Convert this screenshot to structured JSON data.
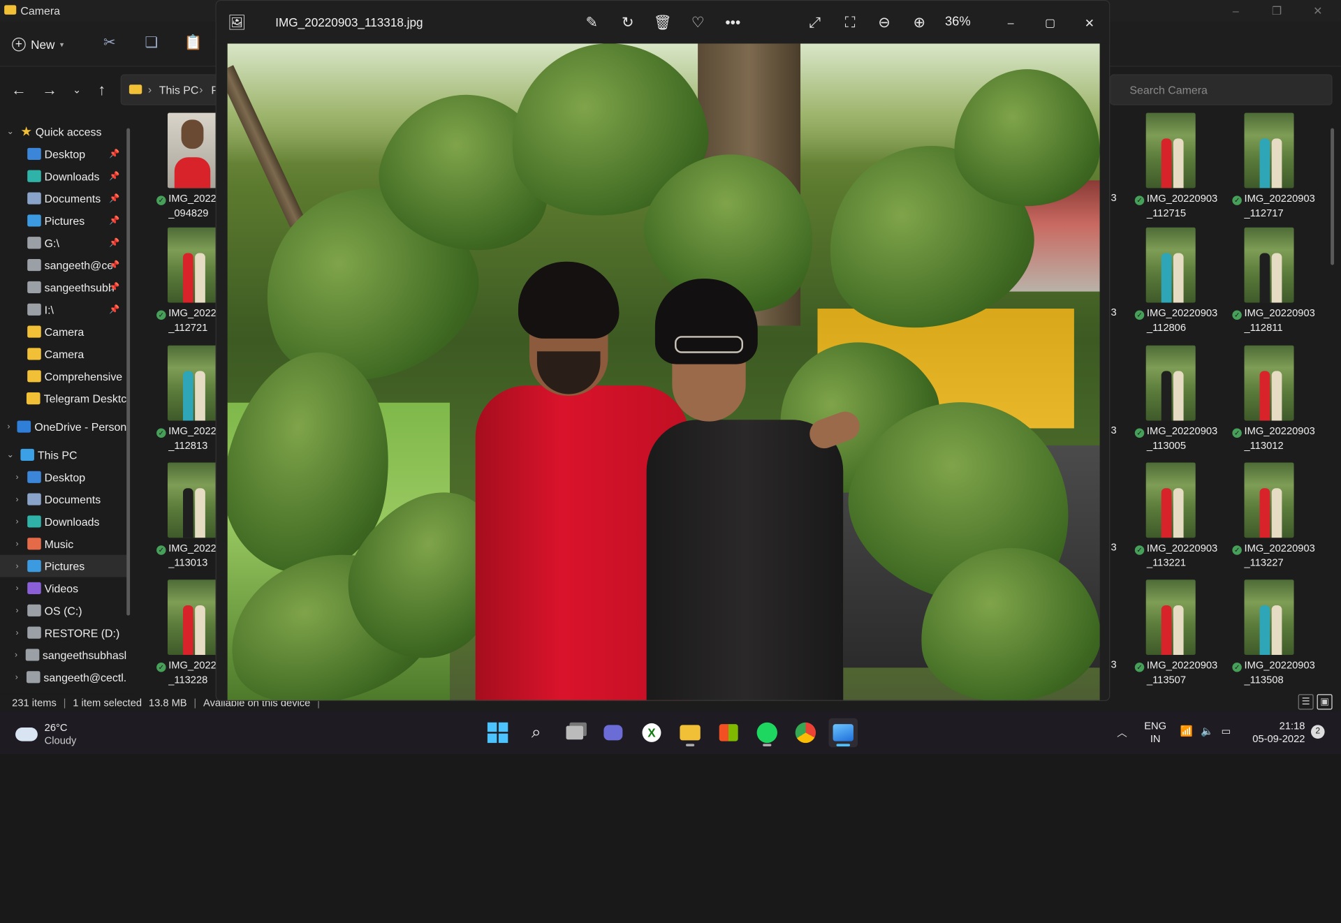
{
  "explorer": {
    "window_title": "Camera",
    "new_label": "New",
    "breadcrumb": [
      "This PC",
      "P"
    ],
    "search_placeholder": "Search Camera",
    "nav": {
      "quick_access": "Quick access",
      "items": [
        "Desktop",
        "Downloads",
        "Documents",
        "Pictures",
        "G:\\",
        "sangeeth@ce",
        "sangeethsubh",
        "I:\\",
        "Camera",
        "Camera",
        "Comprehensive",
        "Telegram Desktc",
        "OneDrive - Person",
        "This PC",
        "Desktop",
        "Documents",
        "Downloads",
        "Music",
        "Pictures",
        "Videos",
        "OS (C:)",
        "RESTORE (D:)",
        "sangeethsubhasl",
        "sangeeth@cectl."
      ]
    },
    "left_files": [
      {
        "line1": "IMG_2022",
        "line2": "_094829"
      },
      {
        "line1": "IMG_2022",
        "line2": "_112721"
      },
      {
        "line1": "IMG_2022",
        "line2": "_112813"
      },
      {
        "line1": "IMG_2022",
        "line2": "_113013"
      },
      {
        "line1": "IMG_2022",
        "line2": "_113228"
      }
    ],
    "right_files": [
      {
        "line1": "IMG_20220903",
        "line2": "_112715"
      },
      {
        "line1": "IMG_20220903",
        "line2": "_112717"
      },
      {
        "line1": "IMG_20220903",
        "line2": "_112806"
      },
      {
        "line1": "IMG_20220903",
        "line2": "_112811"
      },
      {
        "line1": "IMG_20220903",
        "line2": "_113005"
      },
      {
        "line1": "IMG_20220903",
        "line2": "_113012"
      },
      {
        "line1": "IMG_20220903",
        "line2": "_113221"
      },
      {
        "line1": "IMG_20220903",
        "line2": "_113227"
      },
      {
        "line1": "IMG_20220903",
        "line2": "_113507"
      },
      {
        "line1": "IMG_20220903",
        "line2": "_113508"
      }
    ],
    "partial_digit": "3",
    "status": {
      "items": "231 items",
      "selected": "1 item selected",
      "size": "13.8 MB",
      "availability": "Available on this device"
    }
  },
  "viewer": {
    "filename": "IMG_20220903_113318.jpg",
    "zoom": "36%"
  },
  "taskbar": {
    "temperature": "26°C",
    "condition": "Cloudy",
    "lang": "ENG",
    "region": "IN",
    "time": "21:18",
    "date": "05-09-2022",
    "notifications": "2"
  },
  "colors": {
    "accent": "#4cc2ff",
    "folder": "#f2c037",
    "checkmark": "#47a05a"
  }
}
